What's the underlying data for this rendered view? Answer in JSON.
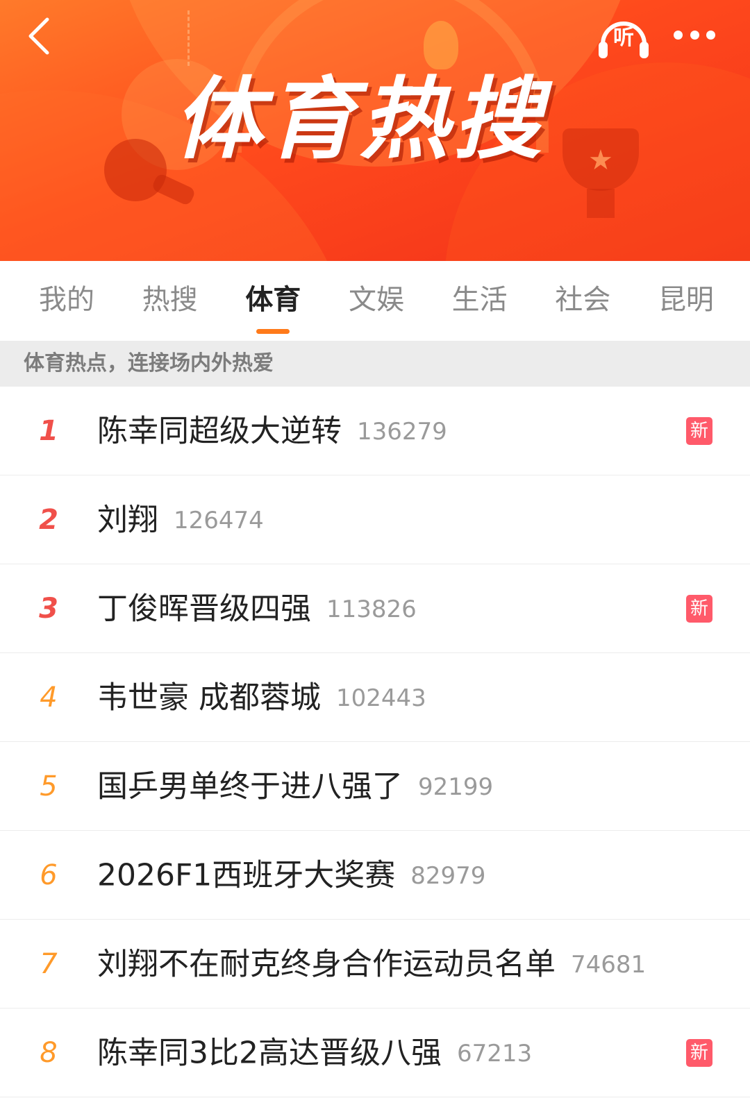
{
  "header": {
    "banner_title": "体育热搜",
    "listen_label": "听",
    "icons": {
      "back": "chevron-left-icon",
      "listen": "headphones-icon",
      "more": "more-dots-icon"
    }
  },
  "tabs": [
    {
      "label": "我的",
      "active": false
    },
    {
      "label": "热搜",
      "active": false
    },
    {
      "label": "体育",
      "active": true
    },
    {
      "label": "文娱",
      "active": false
    },
    {
      "label": "生活",
      "active": false
    },
    {
      "label": "社会",
      "active": false
    },
    {
      "label": "昆明",
      "active": false
    }
  ],
  "subtitle": "体育热点，连接场内外热爱",
  "list": [
    {
      "rank": "1",
      "title": "陈幸同超级大逆转",
      "count": "136279",
      "badge": "新"
    },
    {
      "rank": "2",
      "title": "刘翔",
      "count": "126474",
      "badge": ""
    },
    {
      "rank": "3",
      "title": "丁俊晖晋级四强",
      "count": "113826",
      "badge": "新"
    },
    {
      "rank": "4",
      "title": "韦世豪 成都蓉城",
      "count": "102443",
      "badge": ""
    },
    {
      "rank": "5",
      "title": "国乒男单终于进八强了",
      "count": "92199",
      "badge": ""
    },
    {
      "rank": "6",
      "title": "2026F1西班牙大奖赛",
      "count": "82979",
      "badge": ""
    },
    {
      "rank": "7",
      "title": "刘翔不在耐克终身合作运动员名单",
      "count": "74681",
      "badge": ""
    },
    {
      "rank": "8",
      "title": "陈幸同3比2高达晋级八强",
      "count": "67213",
      "badge": "新"
    }
  ],
  "colors": {
    "banner_gradient_start": "#ff7a2a",
    "banner_gradient_end": "#f2301a",
    "rank_top": "#f0504a",
    "rank_rest": "#ff9a2a",
    "tab_indicator": "#ff7a1a",
    "new_badge": "#ff5a6a"
  }
}
